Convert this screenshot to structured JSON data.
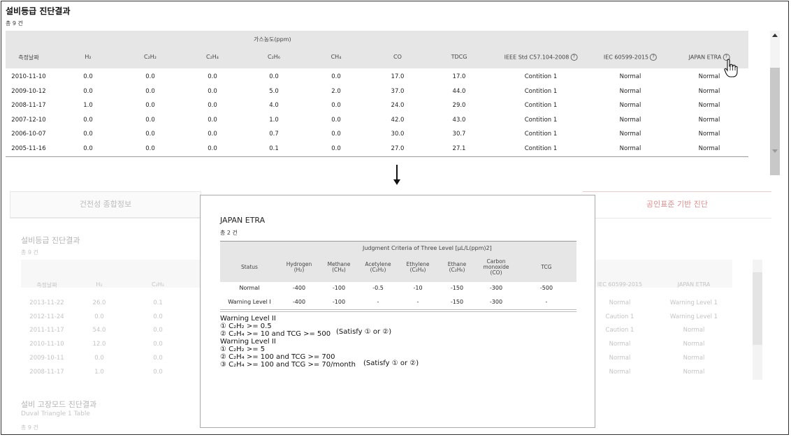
{
  "top": {
    "title": "설비등급 진단결과",
    "count": "총 9 건",
    "gas_group": "가스농도(ppm)",
    "headers": [
      "측정날짜",
      "H₂",
      "C₂H₂",
      "C₂H₄",
      "C₂H₆",
      "CH₄",
      "CO",
      "TDCG",
      "IEEE Std C57.104-2008",
      "IEC 60599-2015",
      "JAPAN ETRA"
    ],
    "rows": [
      [
        "2010-11-10",
        "0.0",
        "0.0",
        "0.0",
        "0.0",
        "0.0",
        "17.0",
        "17.0",
        "Contition 1",
        "Normal",
        "Normal"
      ],
      [
        "2009-10-12",
        "0.0",
        "0.0",
        "0.0",
        "5.0",
        "2.0",
        "37.0",
        "44.0",
        "Contition 1",
        "Normal",
        "Normal"
      ],
      [
        "2008-11-17",
        "1.0",
        "0.0",
        "0.0",
        "4.0",
        "0.0",
        "24.0",
        "29.0",
        "Contition 1",
        "Normal",
        "Normal"
      ],
      [
        "2007-12-10",
        "0.0",
        "0.0",
        "0.0",
        "1.0",
        "0.0",
        "42.0",
        "43.0",
        "Contition 1",
        "Normal",
        "Normal"
      ],
      [
        "2006-10-07",
        "0.0",
        "0.0",
        "0.0",
        "0.7",
        "0.0",
        "30.0",
        "30.7",
        "Contition 1",
        "Normal",
        "Normal"
      ],
      [
        "2005-11-16",
        "0.0",
        "0.0",
        "0.0",
        "0.1",
        "0.0",
        "27.0",
        "27.1",
        "Contition 1",
        "Normal",
        "Normal"
      ]
    ]
  },
  "background": {
    "tab1": "건전성 종합정보",
    "tab3": "공인표준 기반 진단",
    "title": "설비등급 진단결과",
    "count": "총 9 건",
    "headers": [
      "측정날짜",
      "H₂",
      "C₂H₂",
      "IEC 60599-2015",
      "JAPAN ETRA"
    ],
    "rows": [
      [
        "2013-11-22",
        "26.0",
        "0.1",
        "Normal",
        "Warning Level 1"
      ],
      [
        "2012-11-24",
        "0.0",
        "0.0",
        "Caution 1",
        "Warning Level 1"
      ],
      [
        "2011-11-17",
        "54.0",
        "0.0",
        "Caution 1",
        "Normal"
      ],
      [
        "2010-11-10",
        "12.0",
        "0.0",
        "Normal",
        "Normal"
      ],
      [
        "2009-10-11",
        "0.0",
        "0.0",
        "Normal",
        "Normal"
      ],
      [
        "2008-11-17",
        "1.0",
        "0.0",
        "Normal",
        "Normal"
      ]
    ],
    "sec2_title": "설비 고장모드 진단결과",
    "sec2_sub": "Duval Triangle 1 Table",
    "sec2_count": "총 9 건"
  },
  "popup": {
    "title": "JAPAN ETRA",
    "count": "총 2 건",
    "group": "Judgment Criteria of Three Level [μL/L(ppm)2]",
    "headers": [
      "Status",
      "Hydrogen\n(H₂)",
      "Methane\n(CH₄)",
      "Acetylene\n(C₂H₂)",
      "Ethylene\n(C₂H₄)",
      "Ethane\n(C₂H₆)",
      "Carbon\nmonoxide\n(CO)",
      "TCG"
    ],
    "rows": [
      [
        "Normal",
        "-400",
        "-100",
        "-0.5",
        "-10",
        "-150",
        "-300",
        "-500"
      ],
      [
        "Warning Level I",
        "-400",
        "-100",
        "-",
        "-",
        "-150",
        "-300",
        "-"
      ]
    ],
    "notes": {
      "block1_title": "Warning Level II",
      "block1_line1": "① C₂H₂ >= 0.5",
      "block1_line2": "② C₂H₄ >= 10 and TCG >= 500",
      "block1_satisfy": "(Satisfy ① or ②)",
      "block2_title": "Warning Level II",
      "block2_line1": "① C₂H₂ >= 5",
      "block2_line2": "② C₂H₄ >= 100 and TCG >= 700",
      "block2_line3": "③ C₂H₄ >= 100 and TCG >= 70/month",
      "block2_satisfy": "(Satisfy ① or ②)"
    }
  },
  "icons": {
    "help": "question-circle-icon",
    "cursor": "hand-pointer-icon",
    "arrow": "arrow-down-icon"
  }
}
